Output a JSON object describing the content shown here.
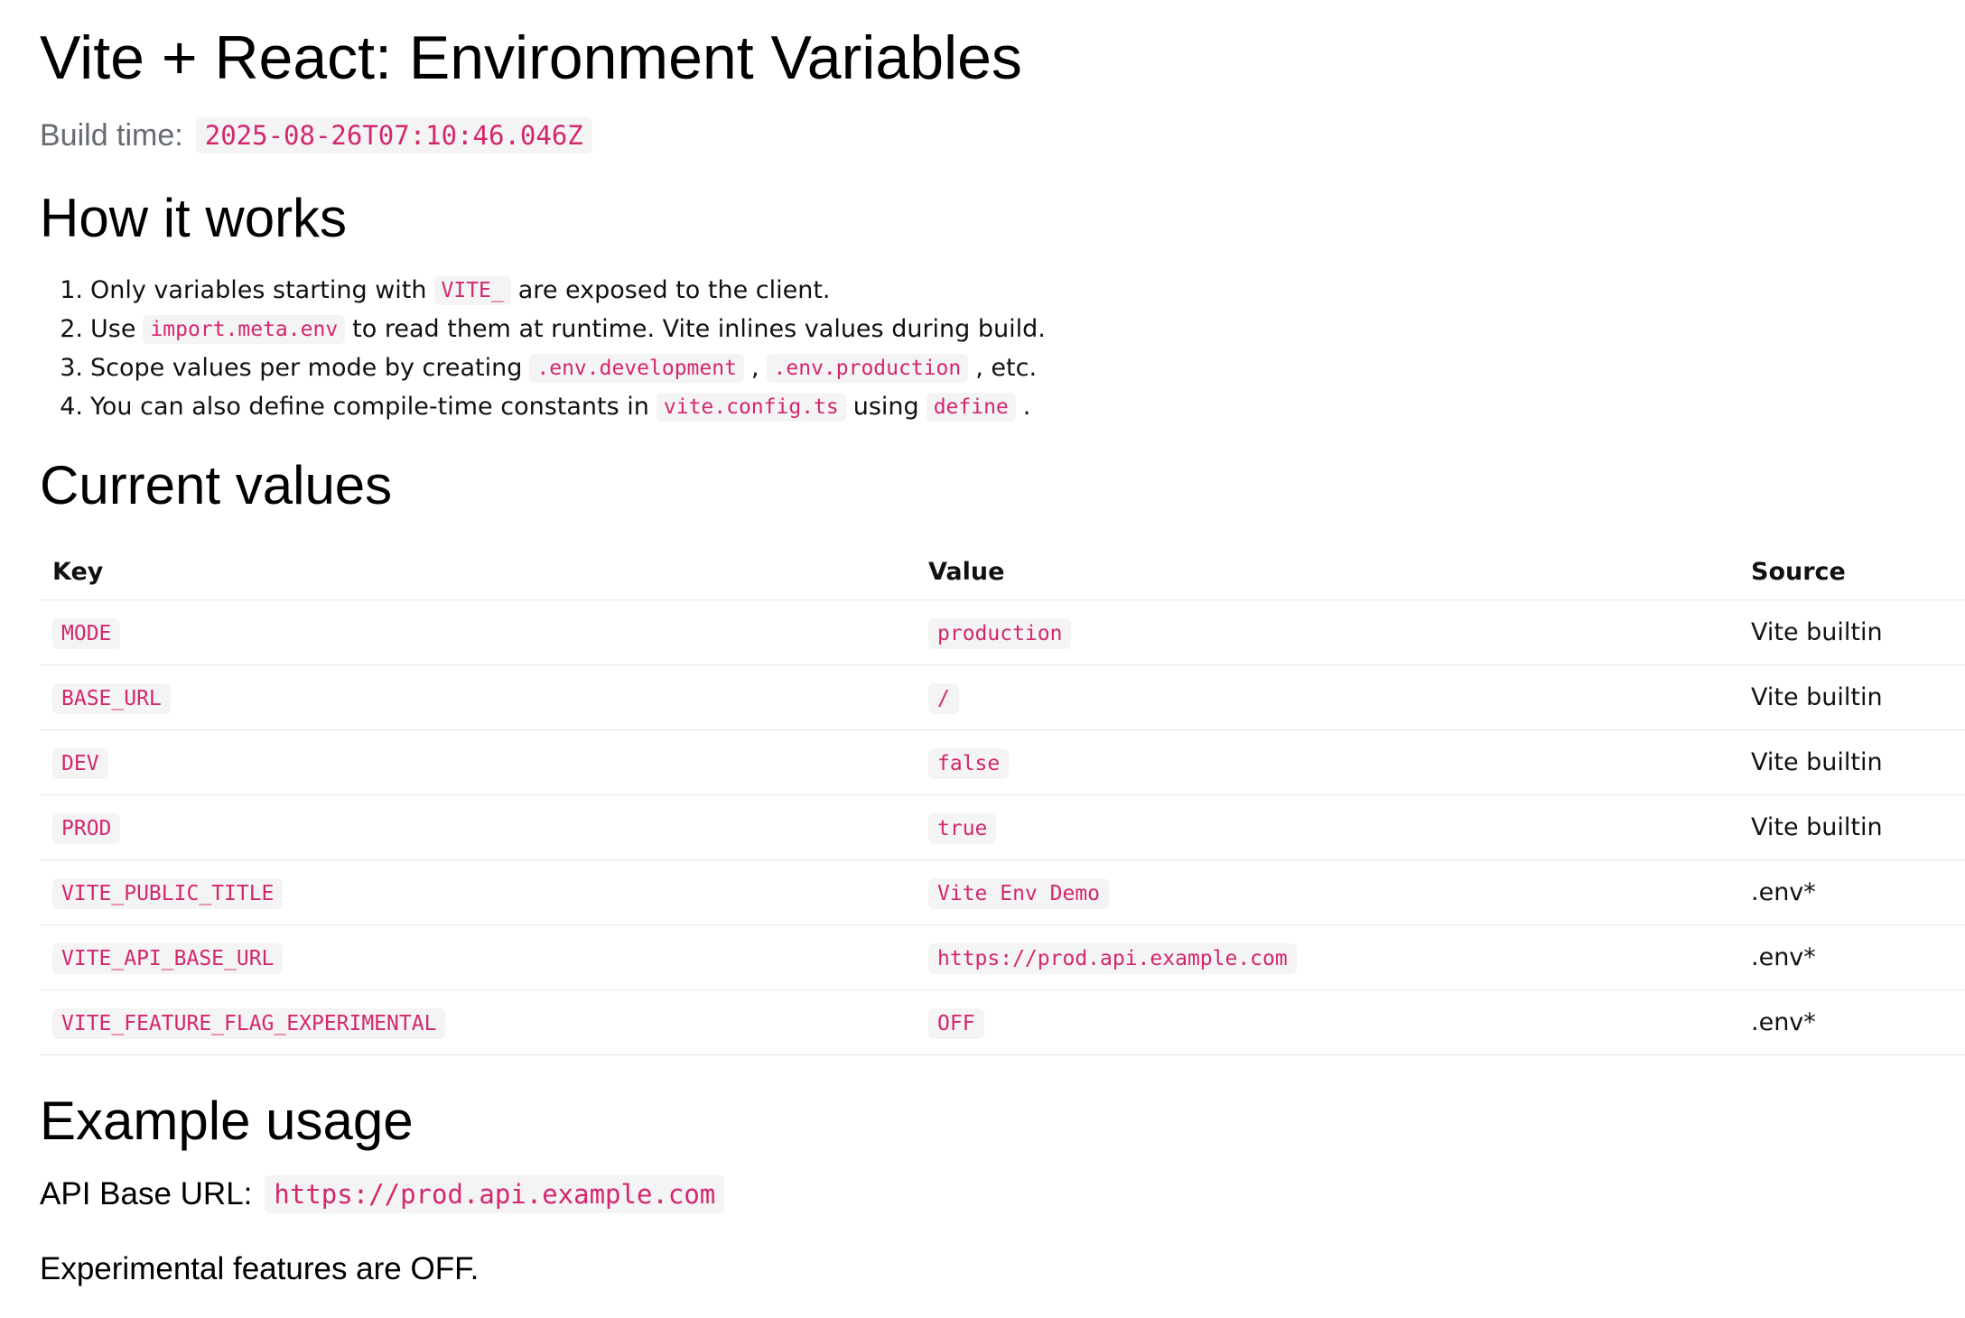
{
  "header": {
    "title": "Vite + React: Environment Variables",
    "build_time_label": "Build time:",
    "build_time_value": "2025-08-26T07:10:46.046Z"
  },
  "how_it_works": {
    "heading": "How it works",
    "steps": [
      {
        "num": "1.",
        "parts": [
          "Only variables starting with",
          "VITE_",
          "are exposed to the client."
        ]
      },
      {
        "num": "2.",
        "parts": [
          "Use",
          "import.meta.env",
          "to read them at runtime. Vite inlines values during build."
        ]
      },
      {
        "num": "3.",
        "parts": [
          "Scope values per mode by creating",
          ".env.development",
          ",",
          ".env.production",
          ", etc."
        ]
      },
      {
        "num": "4.",
        "parts": [
          "You can also define compile-time constants in",
          "vite.config.ts",
          "using",
          "define",
          "."
        ]
      }
    ]
  },
  "current_values": {
    "heading": "Current values",
    "columns": [
      "Key",
      "Value",
      "Source"
    ],
    "rows": [
      {
        "key": "MODE",
        "value": "production",
        "source": "Vite builtin"
      },
      {
        "key": "BASE_URL",
        "value": "/",
        "source": "Vite builtin"
      },
      {
        "key": "DEV",
        "value": "false",
        "source": "Vite builtin"
      },
      {
        "key": "PROD",
        "value": "true",
        "source": "Vite builtin"
      },
      {
        "key": "VITE_PUBLIC_TITLE",
        "value": "Vite Env Demo",
        "source": ".env*"
      },
      {
        "key": "VITE_API_BASE_URL",
        "value": "https://prod.api.example.com",
        "source": ".env*"
      },
      {
        "key": "VITE_FEATURE_FLAG_EXPERIMENTAL",
        "value": "OFF",
        "source": ".env*"
      }
    ]
  },
  "example_usage": {
    "heading": "Example usage",
    "api_label": "API Base URL:",
    "api_value": "https://prod.api.example.com",
    "experimental_text": "Experimental features are OFF."
  },
  "colors": {
    "code_text": "#d3276f",
    "code_bg": "#f4f4f5",
    "muted_text": "#666b72",
    "row_border": "#e6e6e6"
  }
}
